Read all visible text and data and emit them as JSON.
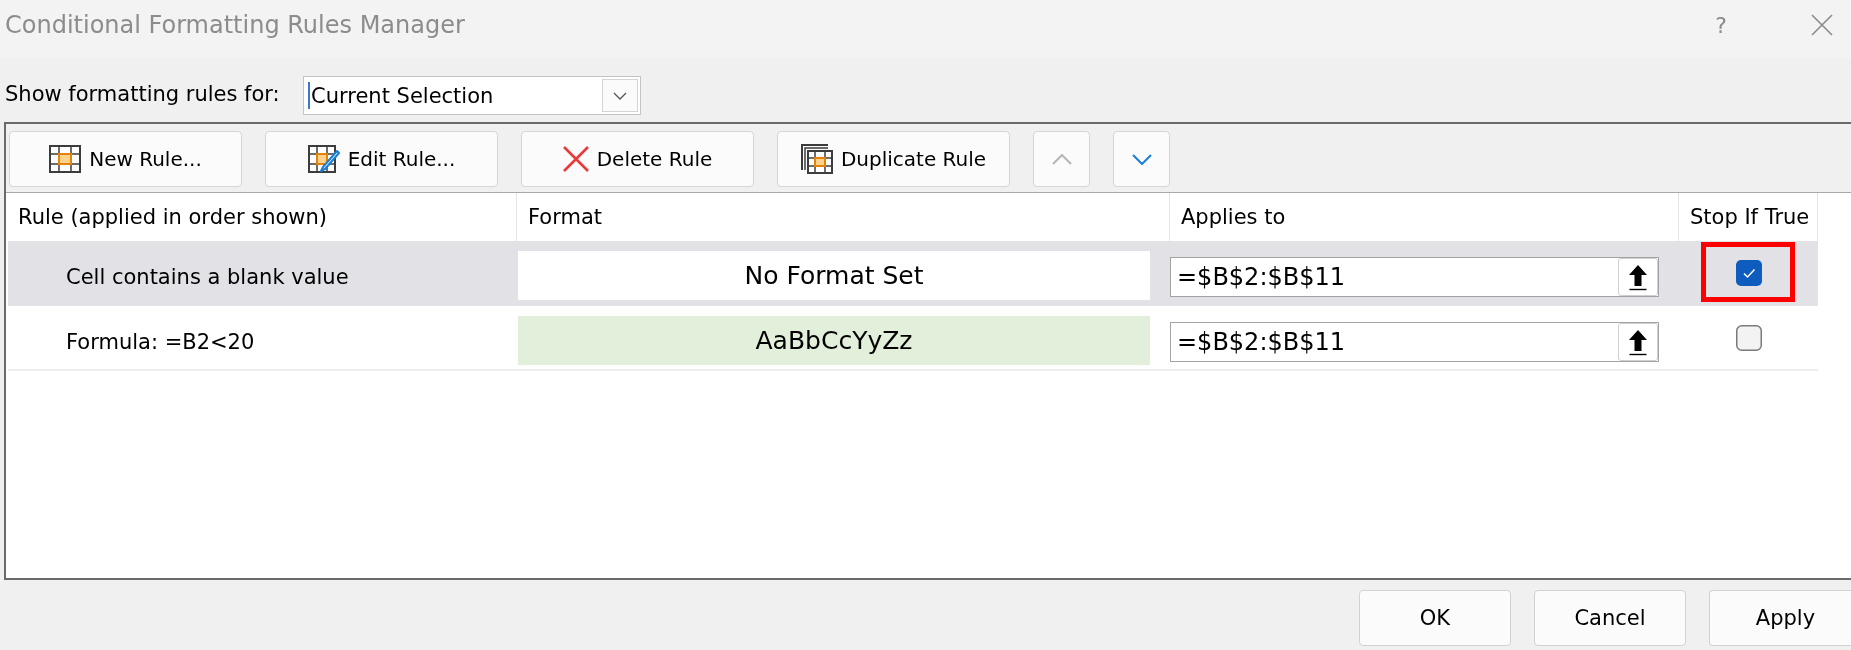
{
  "window": {
    "title": "Conditional Formatting Rules Manager",
    "help": "?"
  },
  "scope": {
    "label": "Show formatting rules for:",
    "value": "Current Selection",
    "focused": true
  },
  "toolbar": [
    {
      "kind": "new",
      "label": "New Rule...",
      "disabled": false
    },
    {
      "kind": "edit",
      "label": "Edit Rule...",
      "disabled": false
    },
    {
      "kind": "delete",
      "label": "Delete Rule",
      "disabled": false
    },
    {
      "kind": "duplicate",
      "label": "Duplicate Rule",
      "disabled": false
    },
    {
      "kind": "up",
      "disabled": true
    },
    {
      "kind": "down",
      "disabled": false
    }
  ],
  "table": {
    "columns": [
      "Rule (applied in order shown)",
      "Format",
      "Applies to",
      "Stop If True"
    ],
    "rows": [
      {
        "rule": "Cell contains a blank value",
        "format": {
          "text": "No Format Set",
          "color": "#ffffff"
        },
        "applies_to": "=$B$2:$B$11",
        "stop_if_true": true,
        "highlighted": true,
        "selected": true
      },
      {
        "rule": "Formula: =B2<20",
        "format": {
          "text": "AaBbCcYyZz",
          "color": "#e2efda"
        },
        "applies_to": "=$B$2:$B$11",
        "stop_if_true": false,
        "highlighted": false,
        "selected": false
      }
    ]
  },
  "buttons": [
    "OK",
    "Cancel",
    "Apply"
  ]
}
